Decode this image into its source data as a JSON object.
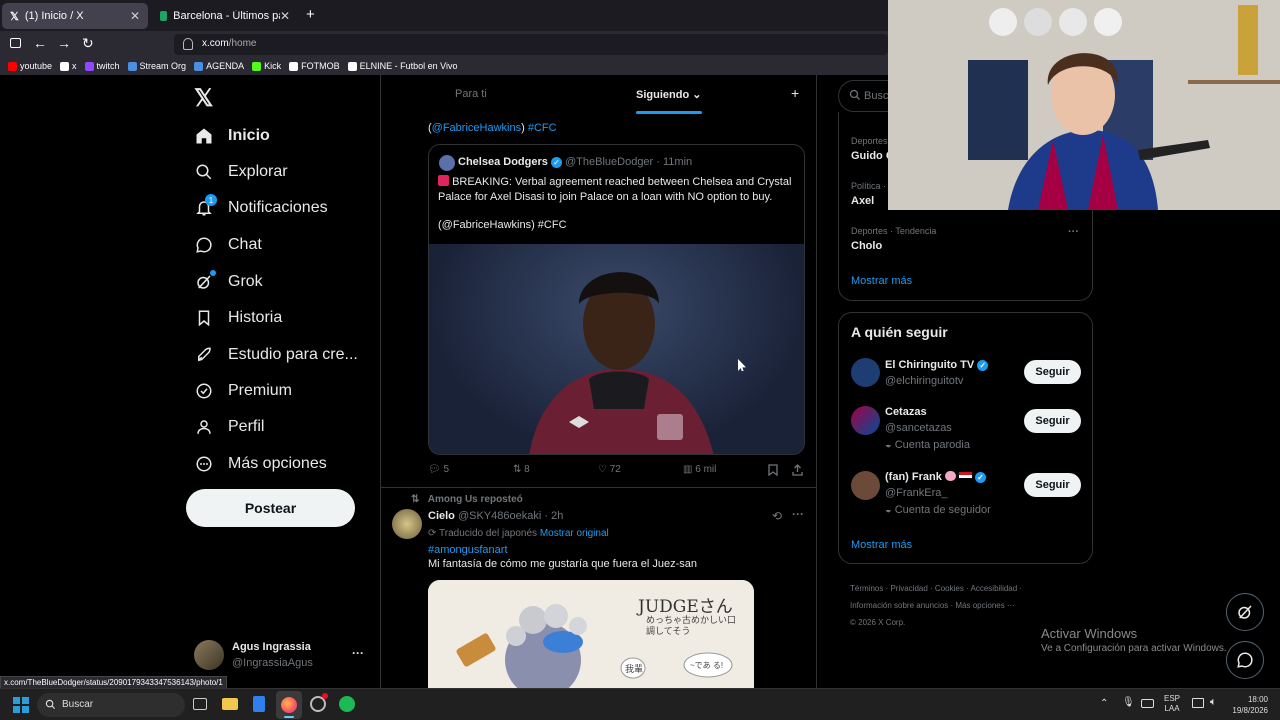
{
  "browser": {
    "tabs": [
      {
        "label": "(1) Inicio / X",
        "active": true
      },
      {
        "label": "Barcelona - Últimos partidos, p",
        "active": false
      }
    ],
    "new_tab": "+",
    "url_host": "x.com",
    "url_path": "/home",
    "bookmarks": [
      {
        "label": "youtube",
        "color": "#ff0000"
      },
      {
        "label": "x",
        "color": "#ffffff"
      },
      {
        "label": "twitch",
        "color": "#9146ff"
      },
      {
        "label": "Stream Org",
        "color": "#4a90e2"
      },
      {
        "label": "AGENDA",
        "color": "#4a90e2"
      },
      {
        "label": "Kick",
        "color": "#53fc18"
      },
      {
        "label": "FOTMOB",
        "color": "#ffffff"
      },
      {
        "label": "ELNINE - Futbol en Vivo",
        "color": "#ffffff"
      }
    ],
    "status_url": "x.com/TheBlueDodger/status/2090179343347536143/photo/1"
  },
  "nav": {
    "items": [
      {
        "label": "Inicio",
        "icon": "home-icon"
      },
      {
        "label": "Explorar",
        "icon": "search-icon"
      },
      {
        "label": "Notificaciones",
        "icon": "bell-icon",
        "badge": "1"
      },
      {
        "label": "Chat",
        "icon": "chat-icon"
      },
      {
        "label": "Grok",
        "icon": "grok-icon"
      },
      {
        "label": "Historia",
        "icon": "bookmark-icon"
      },
      {
        "label": "Estudio para cre...",
        "icon": "rocket-icon"
      },
      {
        "label": "Premium",
        "icon": "verified-icon"
      },
      {
        "label": "Perfil",
        "icon": "person-icon"
      },
      {
        "label": "Más opciones",
        "icon": "more-circle-icon"
      }
    ],
    "post_button": "Postear",
    "account": {
      "name": "Agus Ingrassia",
      "handle": "@IngrassiaAgus",
      "more": "···"
    }
  },
  "feed": {
    "tabs": [
      "Para ti",
      "Siguiendo"
    ],
    "tab_add": "+",
    "post1": {
      "top_line_mention": "@FabriceHawkins",
      "top_line_tag": "#CFC",
      "quote": {
        "name": "Chelsea Dodgers",
        "handle": "@TheBlueDodger",
        "time": "· 11min",
        "text": "BREAKING: Verbal agreement reached between Chelsea and Crystal Palace for Axel Disasi to join Palace on a loan with NO option to buy.",
        "text2": "(@FabriceHawkins) #CFC"
      },
      "actions": {
        "replies": "5",
        "reposts": "8",
        "likes": "72",
        "views": "6 mil"
      }
    },
    "post2": {
      "repost_label": "Among Us reposteó",
      "name": "Cielo",
      "handle": "@SKY486oekaki",
      "time": "· 2h",
      "translated": "Traducido del japonés",
      "show_original": "Mostrar original",
      "hashtag": "#amongusfanart",
      "text": "Mi fantasía de cómo me gustaría que fuera el Juez-san",
      "image_text_1": "JUDGEさん",
      "image_text_2": "めっちゃ古めかしい口調してそう",
      "image_text_3": "我輩",
      "image_text_4": "~であ る!"
    }
  },
  "right": {
    "search_placeholder": "Buscar",
    "trends": [
      {
        "category": "Deportes ·",
        "title": "Guido C"
      },
      {
        "category": "Política ·",
        "title": "Axel"
      },
      {
        "category": "Deportes · Tendencia",
        "title": "Cholo"
      }
    ],
    "trends_more": "Mostrar más",
    "who_to_follow": {
      "title": "A quién seguir",
      "accounts": [
        {
          "name": "El Chiringuito TV",
          "handle": "@elchiringuitotv",
          "note": "",
          "button": "Seguir"
        },
        {
          "name": "Cetazas",
          "handle": "@sancetazas",
          "note": "Cuenta parodia",
          "button": "Seguir"
        },
        {
          "name": "(fan) Frank",
          "handle": "@FrankEra_",
          "note": "Cuenta de seguidor",
          "button": "Seguir"
        }
      ],
      "more": "Mostrar más"
    },
    "footer": [
      "Términos",
      "Privacidad",
      "Cookies",
      "Accesibilidad",
      "Información sobre anuncios",
      "Más opciones ···",
      "© 2026 X Corp."
    ]
  },
  "windows_watermark": {
    "line1": "Activar Windows",
    "line2": "Ve a Configuración para activar Windows."
  },
  "taskbar": {
    "search": "Buscar",
    "lang1": "ESP",
    "lang2": "LAA",
    "time": "18:00",
    "date": "19/8/2026"
  },
  "colors": {
    "accent": "#1d9bf0",
    "border": "#2f3336",
    "muted": "#71767b"
  }
}
